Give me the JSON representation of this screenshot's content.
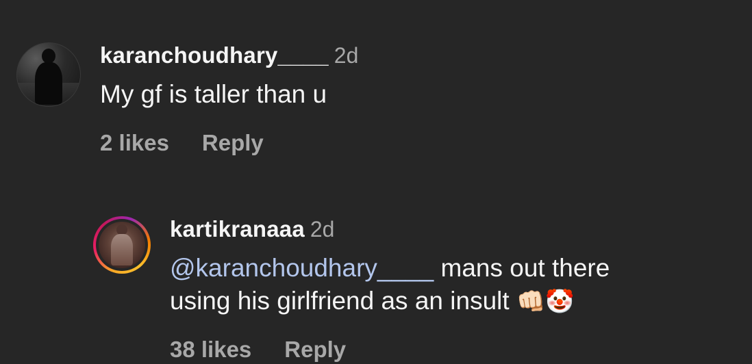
{
  "comments": [
    {
      "username": "karanchoudhary____",
      "time": "2d",
      "text": "My gf is taller than u",
      "likes": "2 likes",
      "reply_label": "Reply"
    },
    {
      "username": "kartikranaaa",
      "time": "2d",
      "mention": "@karanchoudhary____",
      "text_line1": " mans out there",
      "text_line2": "using his girlfriend as an insult ",
      "emoji_fist": "👊🏻",
      "emoji_clown": "🤡",
      "likes": "38 likes",
      "reply_label": "Reply"
    }
  ],
  "colors": {
    "background": "#262626",
    "primary_text": "#f5f5f5",
    "secondary_text": "#a8a8a8",
    "mention": "#b3c6ec"
  }
}
